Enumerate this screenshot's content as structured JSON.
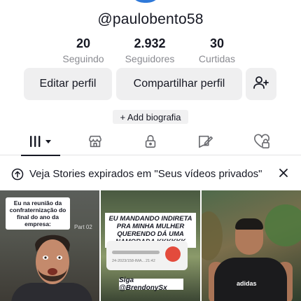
{
  "profile": {
    "username": "@paulobento58",
    "stats": [
      {
        "value": "20",
        "label": "Seguindo"
      },
      {
        "value": "2.932",
        "label": "Seguidores"
      },
      {
        "value": "30",
        "label": "Curtidas"
      }
    ]
  },
  "actions": {
    "edit_label": "Editar perfil",
    "share_label": "Compartilhar perfil",
    "add_bio_label": "+ Add biografia"
  },
  "tabs": [
    {
      "icon": "videos-grid-icon",
      "active": true
    },
    {
      "icon": "shop-icon",
      "active": false
    },
    {
      "icon": "lock-icon",
      "active": false
    },
    {
      "icon": "tagged-icon",
      "active": false
    },
    {
      "icon": "liked-icon",
      "active": false
    }
  ],
  "notice": {
    "text": "Veja Stories expirados em \"Seus vídeos privados\""
  },
  "videos": [
    {
      "caption": "Eu na reunião da confraternização do final do ano da empresa:",
      "part": "Part 02"
    },
    {
      "caption": "EU MANDANDO INDIRETA PRA MINHA MULHER QUERENDO DÁ UMA NAMORADA KKKKKK",
      "audio_meta": "24-2023/158-IMA...",
      "audio_time": "21:42",
      "tag": "Siga @BrendonySx"
    },
    {
      "caption": "",
      "brand_text": "adidas"
    }
  ],
  "colors": {
    "text_primary": "#161823",
    "text_secondary": "#8a8b91",
    "button_bg": "#efeff0"
  }
}
